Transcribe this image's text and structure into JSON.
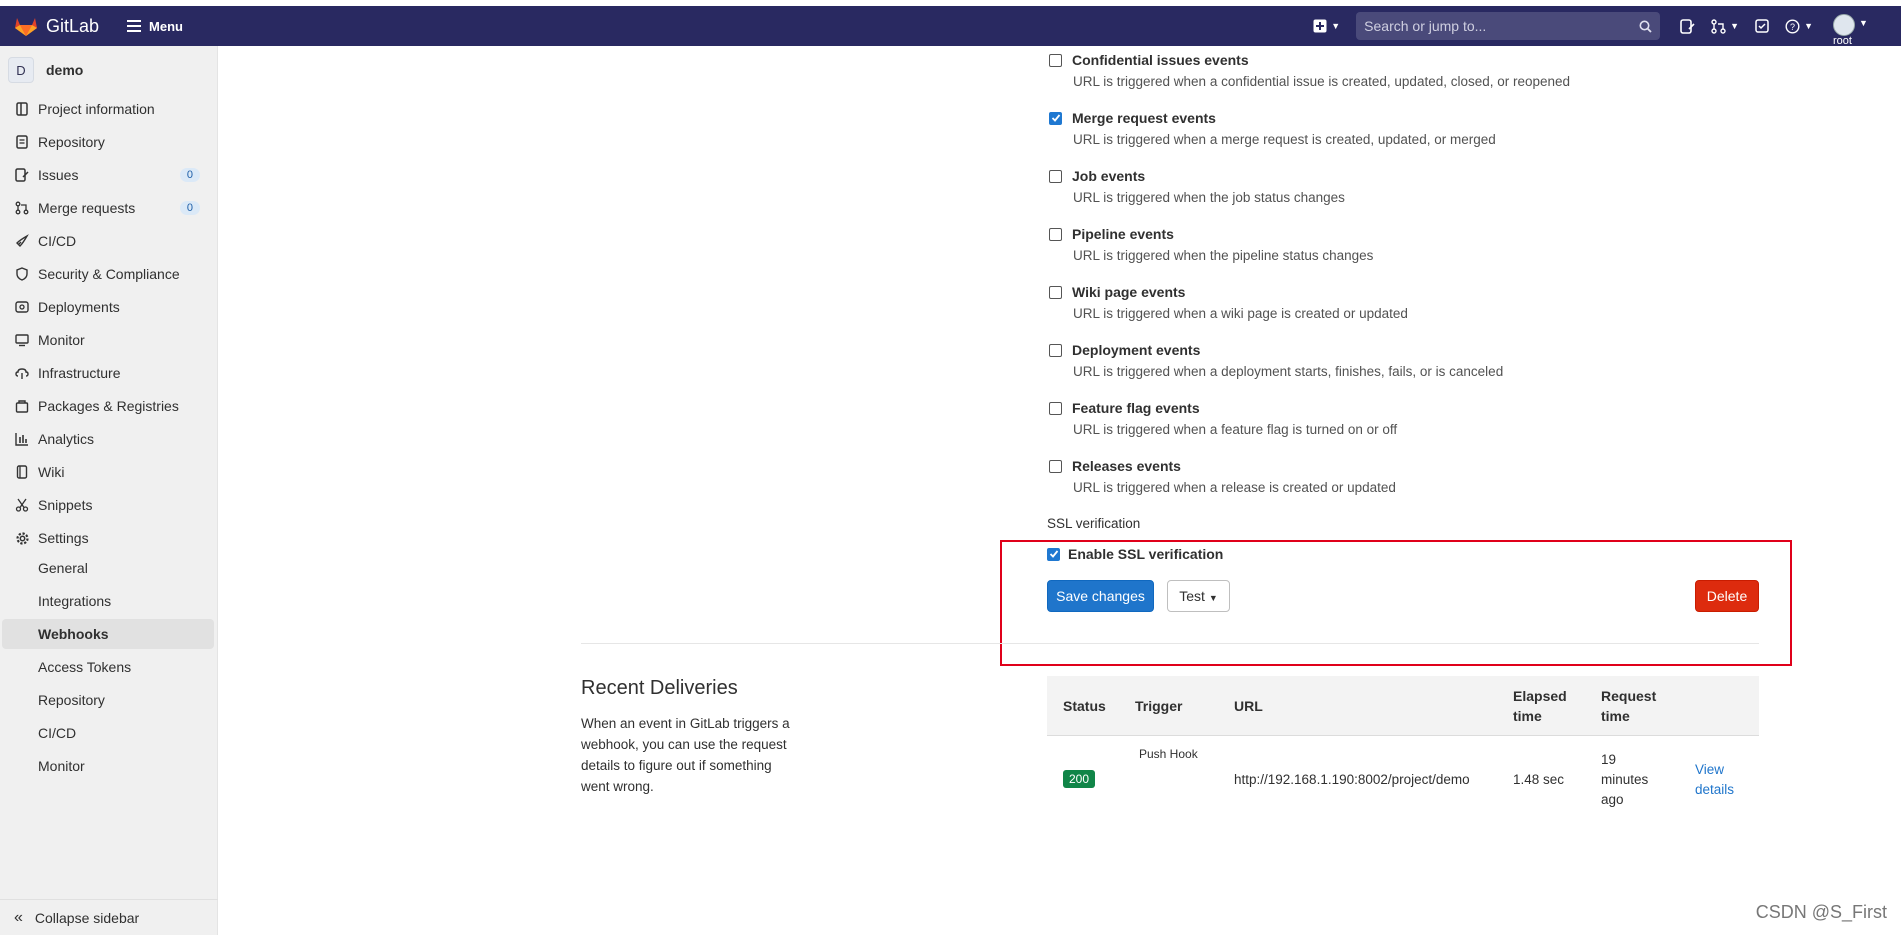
{
  "navbar": {
    "brand": "GitLab",
    "menu_label": "Menu",
    "search_placeholder": "Search or jump to...",
    "user_label": "root",
    "icons": [
      "plus-square-icon",
      "search-icon",
      "issues-icon",
      "merge-request-icon",
      "todo-icon",
      "help-icon"
    ]
  },
  "sidebar": {
    "project_initial": "D",
    "project_name": "demo",
    "items": [
      {
        "label": "Project information",
        "icon": "project-icon"
      },
      {
        "label": "Repository",
        "icon": "doc-icon"
      },
      {
        "label": "Issues",
        "icon": "issues-icon",
        "count": "0"
      },
      {
        "label": "Merge requests",
        "icon": "merge-request-icon",
        "count": "0"
      },
      {
        "label": "CI/CD",
        "icon": "rocket-icon"
      },
      {
        "label": "Security & Compliance",
        "icon": "shield-icon"
      },
      {
        "label": "Deployments",
        "icon": "deployments-icon"
      },
      {
        "label": "Monitor",
        "icon": "monitor-icon"
      },
      {
        "label": "Infrastructure",
        "icon": "cloud-icon"
      },
      {
        "label": "Packages & Registries",
        "icon": "package-icon"
      },
      {
        "label": "Analytics",
        "icon": "chart-icon"
      },
      {
        "label": "Wiki",
        "icon": "book-icon"
      },
      {
        "label": "Snippets",
        "icon": "scissors-icon"
      },
      {
        "label": "Settings",
        "icon": "gear-icon"
      }
    ],
    "sub_items": [
      "General",
      "Integrations",
      "Webhooks",
      "Access Tokens",
      "Repository",
      "CI/CD",
      "Monitor"
    ],
    "active_sub_item": "Webhooks",
    "collapse_label": "Collapse sidebar"
  },
  "events": [
    {
      "title": "Confidential issues events",
      "desc": "URL is triggered when a confidential issue is created, updated, closed, or reopened",
      "checked": false
    },
    {
      "title": "Merge request events",
      "desc": "URL is triggered when a merge request is created, updated, or merged",
      "checked": true
    },
    {
      "title": "Job events",
      "desc": "URL is triggered when the job status changes",
      "checked": false
    },
    {
      "title": "Pipeline events",
      "desc": "URL is triggered when the pipeline status changes",
      "checked": false
    },
    {
      "title": "Wiki page events",
      "desc": "URL is triggered when a wiki page is created or updated",
      "checked": false
    },
    {
      "title": "Deployment events",
      "desc": "URL is triggered when a deployment starts, finishes, fails, or is canceled",
      "checked": false
    },
    {
      "title": "Feature flag events",
      "desc": "URL is triggered when a feature flag is turned on or off",
      "checked": false
    },
    {
      "title": "Releases events",
      "desc": "URL is triggered when a release is created or updated",
      "checked": false
    }
  ],
  "ssl": {
    "section_label": "SSL verification",
    "checkbox_label": "Enable SSL verification",
    "checked": true
  },
  "actions": {
    "save_label": "Save changes",
    "test_label": "Test",
    "delete_label": "Delete"
  },
  "recent": {
    "title": "Recent Deliveries",
    "description": "When an event in GitLab triggers a webhook, you can use the request details to figure out if something went wrong.",
    "columns": {
      "status": "Status",
      "trigger": "Trigger",
      "url": "URL",
      "elapsed_1": "Elapsed",
      "elapsed_2": "time",
      "request_1": "Request",
      "request_2": "time"
    },
    "row": {
      "status": "200",
      "trigger": "Push Hook",
      "url": "http://192.168.1.190:8002/project/demo",
      "elapsed": "1.48 sec",
      "request_1": "19",
      "request_2": "minutes",
      "request_3": "ago",
      "view_1": "View",
      "view_2": "details"
    }
  },
  "watermark": "CSDN @S_First",
  "colors": {
    "navbar": "#292961",
    "primary": "#1f75cb",
    "danger": "#dd2b0e",
    "success": "#108548",
    "highlight": "#e0001a"
  }
}
